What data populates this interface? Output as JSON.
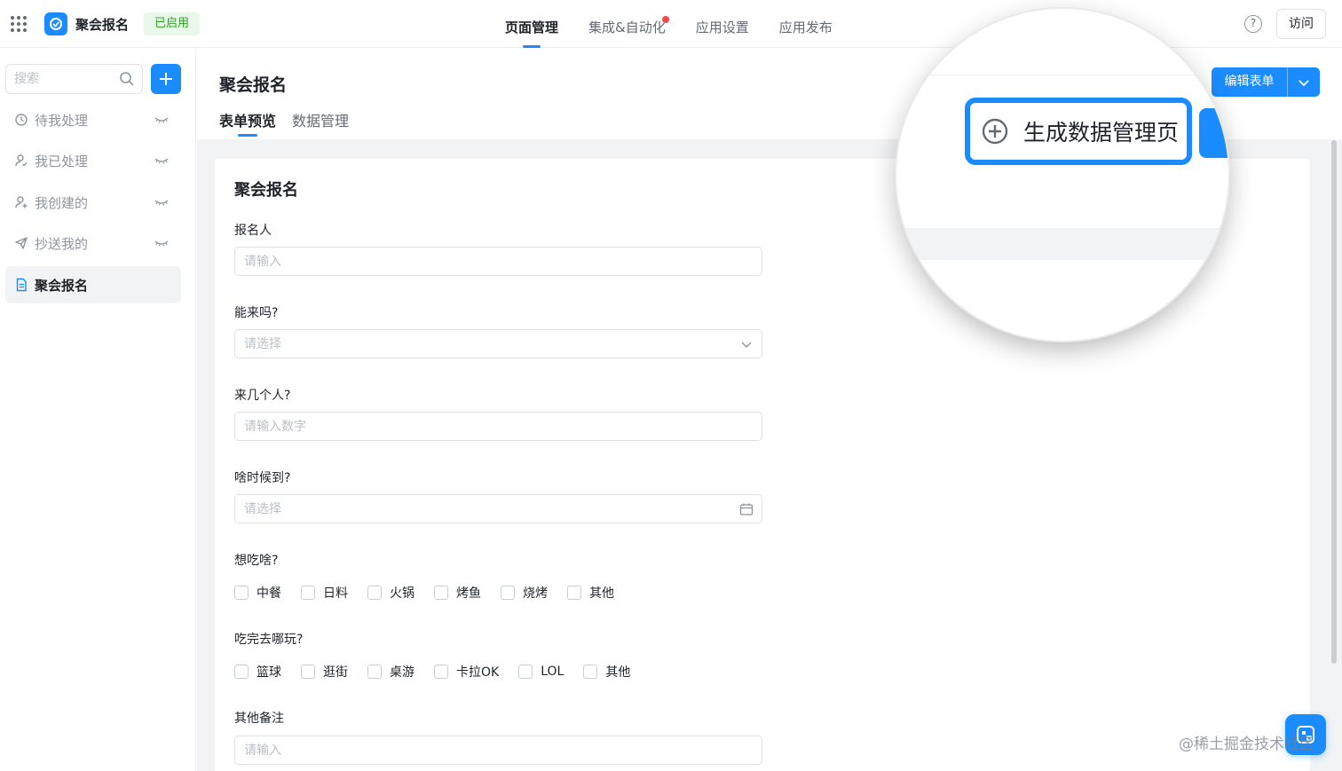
{
  "header": {
    "app_name": "聚会报名",
    "status_badge": "已启用",
    "nav": [
      {
        "label": "页面管理",
        "active": true
      },
      {
        "label": "集成&自动化",
        "active": false,
        "notification_dot": true
      },
      {
        "label": "应用设置",
        "active": false
      },
      {
        "label": "应用发布",
        "active": false
      }
    ],
    "help_icon": "question-circle-icon",
    "visit_label": "访问"
  },
  "sidebar": {
    "search_placeholder": "搜索",
    "add_icon": "plus-icon",
    "items": [
      {
        "label": "待我处理",
        "icon": "clock-icon",
        "hidden": true
      },
      {
        "label": "我已处理",
        "icon": "user-check-icon",
        "hidden": true
      },
      {
        "label": "我创建的",
        "icon": "user-plus-icon",
        "hidden": true
      },
      {
        "label": "抄送我的",
        "icon": "send-icon",
        "hidden": true
      },
      {
        "label": "聚会报名",
        "icon": "document-icon",
        "active": true
      }
    ]
  },
  "main": {
    "title": "聚会报名",
    "tabs": [
      {
        "label": "表单预览",
        "active": true
      },
      {
        "label": "数据管理",
        "active": false
      }
    ],
    "edit_form_label": "编辑表单"
  },
  "form": {
    "title": "聚会报名",
    "fields": [
      {
        "label": "报名人",
        "placeholder": "请输入"
      },
      {
        "label": "能来吗?",
        "placeholder": "请选择",
        "suffix_icon": "chevron-down-icon"
      },
      {
        "label": "来几个人?",
        "placeholder": "请输入数字"
      },
      {
        "label": "啥时候到?",
        "placeholder": "请选择",
        "suffix_icon": "calendar-icon"
      }
    ],
    "food": {
      "label": "想吃啥?",
      "options": [
        "中餐",
        "日料",
        "火锅",
        "烤鱼",
        "烧烤",
        "其他"
      ]
    },
    "play": {
      "label": "吃完去哪玩?",
      "options": [
        "篮球",
        "逛街",
        "桌游",
        "卡拉OK",
        "LOL",
        "其他"
      ]
    },
    "notes": {
      "label": "其他备注",
      "placeholder": "请输入"
    }
  },
  "magnifier": {
    "generate_label": "生成数据管理页",
    "icon": "plus-circle-icon"
  },
  "watermark": "@稀土掘金技术社区",
  "colors": {
    "accent": "#1a8cff",
    "badge_bg": "#e8f8ea",
    "badge_text": "#2ea121",
    "notify": "#f54a45"
  }
}
